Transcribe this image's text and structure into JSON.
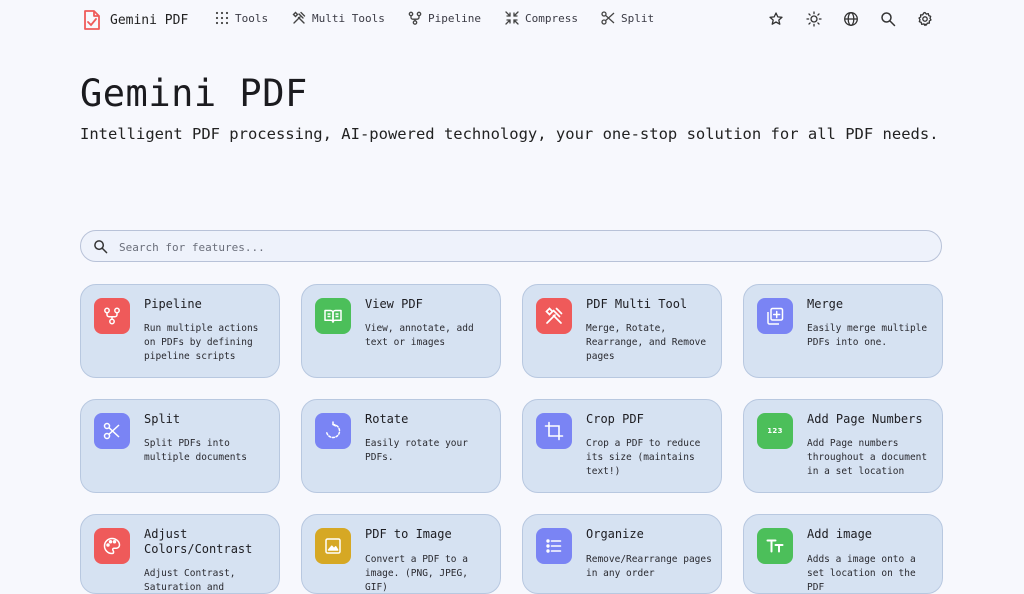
{
  "nav": {
    "brand": "Gemini PDF",
    "items": [
      {
        "label": "Tools",
        "icon": "grid-dots-icon"
      },
      {
        "label": "Multi Tools",
        "icon": "tools-icon"
      },
      {
        "label": "Pipeline",
        "icon": "pipeline-icon"
      },
      {
        "label": "Compress",
        "icon": "compress-icon"
      },
      {
        "label": "Split",
        "icon": "scissors-icon"
      }
    ],
    "right_icons": [
      "star-icon",
      "sun-icon",
      "globe-icon",
      "search-icon",
      "gear-icon"
    ]
  },
  "hero": {
    "title": "Gemini PDF",
    "subtitle": "Intelligent PDF processing, AI-powered technology, your one-stop solution for all PDF needs."
  },
  "search": {
    "placeholder": "Search for features..."
  },
  "colors": {
    "red": "#ef5a5a",
    "green": "#4cbf5a",
    "purple": "#7a84f4",
    "yellow": "#d6a824",
    "card_bg": "#d6e2f2"
  },
  "cards": [
    {
      "title": "Pipeline",
      "desc": "Run multiple actions on PDFs by defining pipeline scripts",
      "icon": "pipeline-icon",
      "color": "#ef5a5a"
    },
    {
      "title": "View PDF",
      "desc": "View, annotate, add text or images",
      "icon": "book-icon",
      "color": "#4cbf5a"
    },
    {
      "title": "PDF Multi Tool",
      "desc": "Merge, Rotate, Rearrange, and Remove pages",
      "icon": "tools-icon",
      "color": "#ef5a5a"
    },
    {
      "title": "Merge",
      "desc": "Easily merge multiple PDFs into one.",
      "icon": "merge-icon",
      "color": "#7a84f4"
    },
    {
      "title": "Split",
      "desc": "Split PDFs into multiple documents",
      "icon": "scissors-icon",
      "color": "#7a84f4"
    },
    {
      "title": "Rotate",
      "desc": "Easily rotate your PDFs.",
      "icon": "rotate-icon",
      "color": "#7a84f4"
    },
    {
      "title": "Crop PDF",
      "desc": "Crop a PDF to reduce its size (maintains text!)",
      "icon": "crop-icon",
      "color": "#7a84f4"
    },
    {
      "title": "Add Page Numbers",
      "desc": "Add Page numbers throughout a document in a set location",
      "icon": "numbers-icon",
      "icon_text": "123",
      "color": "#4cbf5a"
    },
    {
      "title": "Adjust Colors/Contrast",
      "desc": "Adjust Contrast, Saturation and Brightness of a PDF",
      "icon": "palette-icon",
      "color": "#ef5a5a"
    },
    {
      "title": "PDF to Image",
      "desc": "Convert a PDF to a image. (PNG, JPEG, GIF)",
      "icon": "image-icon",
      "color": "#d6a824"
    },
    {
      "title": "Organize",
      "desc": "Remove/Rearrange pages in any order",
      "icon": "list-icon",
      "color": "#7a84f4"
    },
    {
      "title": "Add image",
      "desc": "Adds a image onto a set location on the PDF",
      "icon": "text-size-icon",
      "color": "#4cbf5a"
    }
  ]
}
